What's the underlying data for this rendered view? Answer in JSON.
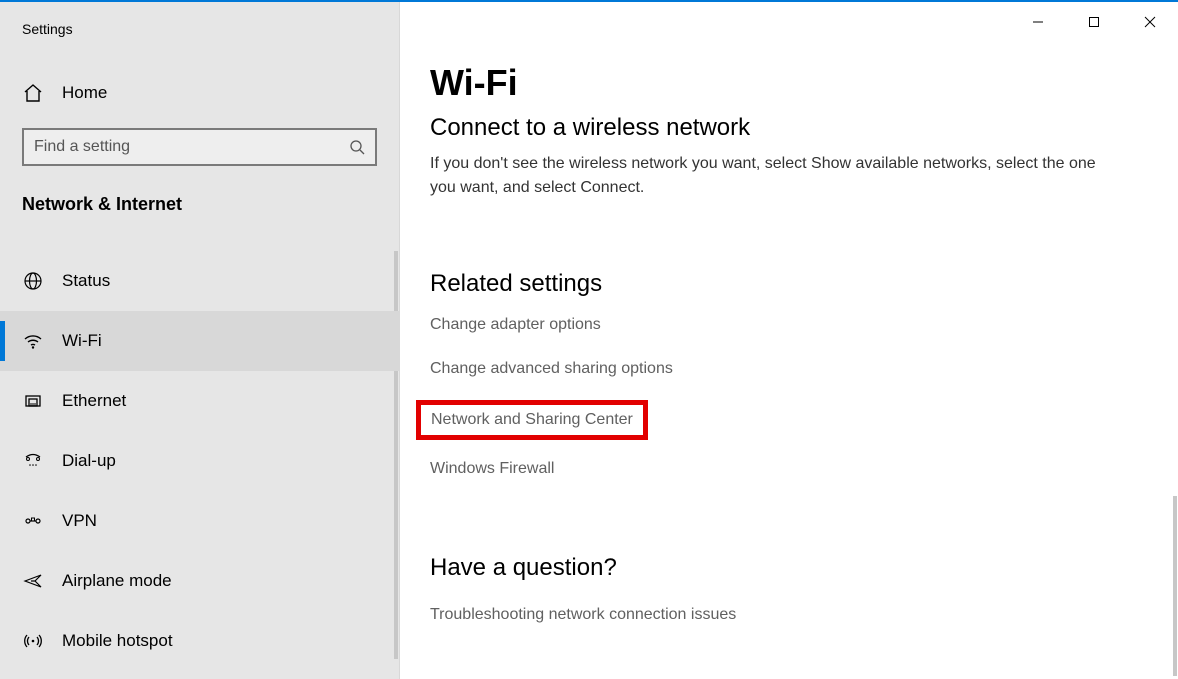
{
  "window": {
    "title": "Settings"
  },
  "sidebar": {
    "home": "Home",
    "search_placeholder": "Find a setting",
    "section": "Network & Internet",
    "items": [
      {
        "label": "Status"
      },
      {
        "label": "Wi-Fi"
      },
      {
        "label": "Ethernet"
      },
      {
        "label": "Dial-up"
      },
      {
        "label": "VPN"
      },
      {
        "label": "Airplane mode"
      },
      {
        "label": "Mobile hotspot"
      }
    ]
  },
  "main": {
    "title": "Wi-Fi",
    "connect_heading": "Connect to a wireless network",
    "connect_body": "If you don't see the wireless network you want, select Show available networks, select the one you want, and select Connect.",
    "related_heading": "Related settings",
    "related_links": [
      "Change adapter options",
      "Change advanced sharing options",
      "Network and Sharing Center",
      "Windows Firewall"
    ],
    "question_heading": "Have a question?",
    "question_link": "Troubleshooting network connection issues"
  }
}
